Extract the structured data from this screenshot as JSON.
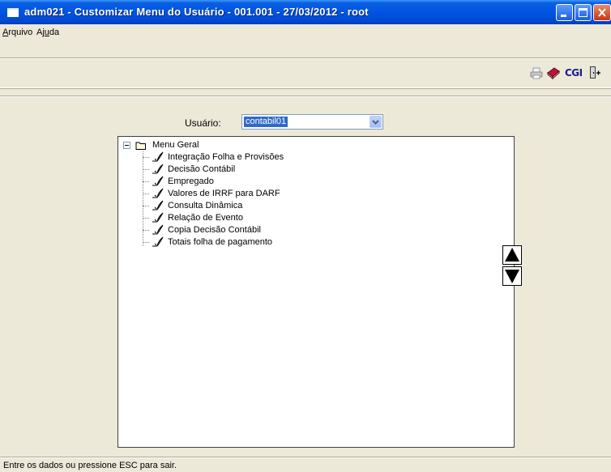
{
  "window": {
    "title": "adm021 - Customizar Menu do Usuário - 001.001 - 27/03/2012 - root",
    "controls": [
      "minimize-icon",
      "maximize-icon",
      "close-icon"
    ],
    "title_bar_color": "#0054e3"
  },
  "menubar": {
    "items": [
      {
        "label_ul": "A",
        "label_rest": "rquivo"
      },
      {
        "label_pre": "Aj",
        "label_ul": "u",
        "label_rest": "da"
      }
    ]
  },
  "toolbar": {
    "icons": [
      "printer-icon",
      "book-icon",
      "cgi-icon",
      "exit-door-icon"
    ],
    "cgi_label": "CGI"
  },
  "form": {
    "user_label": "Usuário:",
    "user_value": "contabil01"
  },
  "tree": {
    "root_label": "Menu Geral",
    "items": [
      "Integração Folha e Provisões",
      "Decisão Contábil",
      "Empregado",
      "Valores de IRRF para DARF",
      "Consulta Dinâmica",
      "Relação de Evento",
      "Copia Decisão Contábil",
      "Totais folha de pagamento"
    ]
  },
  "order_buttons": [
    "move-up-icon",
    "move-down-icon"
  ],
  "status": {
    "text": "Entre os dados ou pressione ESC para sair."
  },
  "colors": {
    "window_bg": "#ece9d8",
    "selection": "#316ac5",
    "close_button": "#c9350f"
  }
}
